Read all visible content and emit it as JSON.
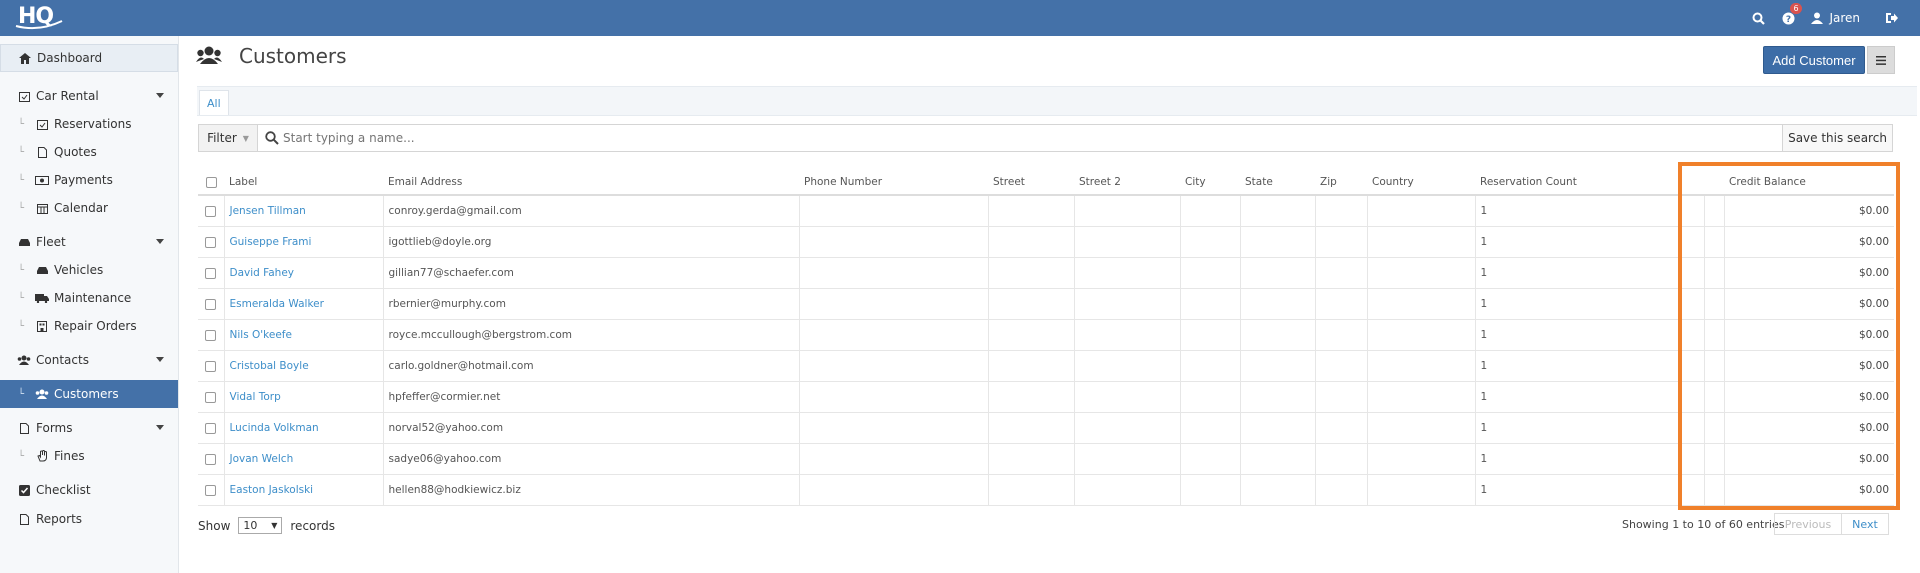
{
  "topbar": {
    "logo": "HQ",
    "notification_count": "6",
    "user_name": "Jaren"
  },
  "sidebar": {
    "items": [
      {
        "label": "Dashboard",
        "icon": "home-icon"
      },
      {
        "label": "Car Rental",
        "icon": "calendar-check-icon"
      },
      {
        "label": "Reservations",
        "icon": "calendar-check-icon"
      },
      {
        "label": "Quotes",
        "icon": "file-icon"
      },
      {
        "label": "Payments",
        "icon": "money-icon"
      },
      {
        "label": "Calendar",
        "icon": "calendar-icon"
      },
      {
        "label": "Fleet",
        "icon": "car-icon"
      },
      {
        "label": "Vehicles",
        "icon": "car-icon"
      },
      {
        "label": "Maintenance",
        "icon": "truck-icon"
      },
      {
        "label": "Repair Orders",
        "icon": "building-icon"
      },
      {
        "label": "Contacts",
        "icon": "users-icon"
      },
      {
        "label": "Customers",
        "icon": "users-icon"
      },
      {
        "label": "Forms",
        "icon": "file-icon"
      },
      {
        "label": "Fines",
        "icon": "hand-icon"
      },
      {
        "label": "Checklist",
        "icon": "check-square-icon"
      },
      {
        "label": "Reports",
        "icon": "file-icon"
      }
    ]
  },
  "page": {
    "title": "Customers",
    "add_button": "Add Customer",
    "tab_all": "All",
    "filter_label": "Filter",
    "search_placeholder": "Start typing a name...",
    "save_search": "Save this search"
  },
  "table": {
    "columns": [
      "Label",
      "Email Address",
      "Phone Number",
      "Street",
      "Street 2",
      "City",
      "State",
      "Zip",
      "Country",
      "Reservation Count",
      "",
      "Credit Balance"
    ],
    "rows": [
      [
        "Jensen Tillman",
        "conroy.gerda@gmail.com",
        "",
        "",
        "",
        "",
        "",
        "",
        "",
        "1",
        "",
        "$0.00"
      ],
      [
        "Guiseppe Frami",
        "igottlieb@doyle.org",
        "",
        "",
        "",
        "",
        "",
        "",
        "",
        "1",
        "",
        "$0.00"
      ],
      [
        "David Fahey",
        "gillian77@schaefer.com",
        "",
        "",
        "",
        "",
        "",
        "",
        "",
        "1",
        "",
        "$0.00"
      ],
      [
        "Esmeralda Walker",
        "rbernier@murphy.com",
        "",
        "",
        "",
        "",
        "",
        "",
        "",
        "1",
        "",
        "$0.00"
      ],
      [
        "Nils O'keefe",
        "royce.mccullough@bergstrom.com",
        "",
        "",
        "",
        "",
        "",
        "",
        "",
        "1",
        "",
        "$0.00"
      ],
      [
        "Cristobal Boyle",
        "carlo.goldner@hotmail.com",
        "",
        "",
        "",
        "",
        "",
        "",
        "",
        "1",
        "",
        "$0.00"
      ],
      [
        "Vidal Torp",
        "hpfeffer@cormier.net",
        "",
        "",
        "",
        "",
        "",
        "",
        "",
        "1",
        "",
        "$0.00"
      ],
      [
        "Lucinda Volkman",
        "norval52@yahoo.com",
        "",
        "",
        "",
        "",
        "",
        "",
        "",
        "1",
        "",
        "$0.00"
      ],
      [
        "Jovan Welch",
        "sadye06@yahoo.com",
        "",
        "",
        "",
        "",
        "",
        "",
        "",
        "1",
        "",
        "$0.00"
      ],
      [
        "Easton Jaskolski",
        "hellen88@hodkiewicz.biz",
        "",
        "",
        "",
        "",
        "",
        "",
        "",
        "1",
        "",
        "$0.00"
      ]
    ]
  },
  "footer": {
    "show_label": "Show",
    "page_length": "10",
    "records_label": "records",
    "info": "Showing 1 to 10 of 60 entries",
    "previous": "Previous",
    "next": "Next"
  },
  "colors": {
    "topbar": "#4471a8",
    "accent": "#3d6da7",
    "link": "#3d8ec9",
    "highlight": "#f0802a"
  }
}
